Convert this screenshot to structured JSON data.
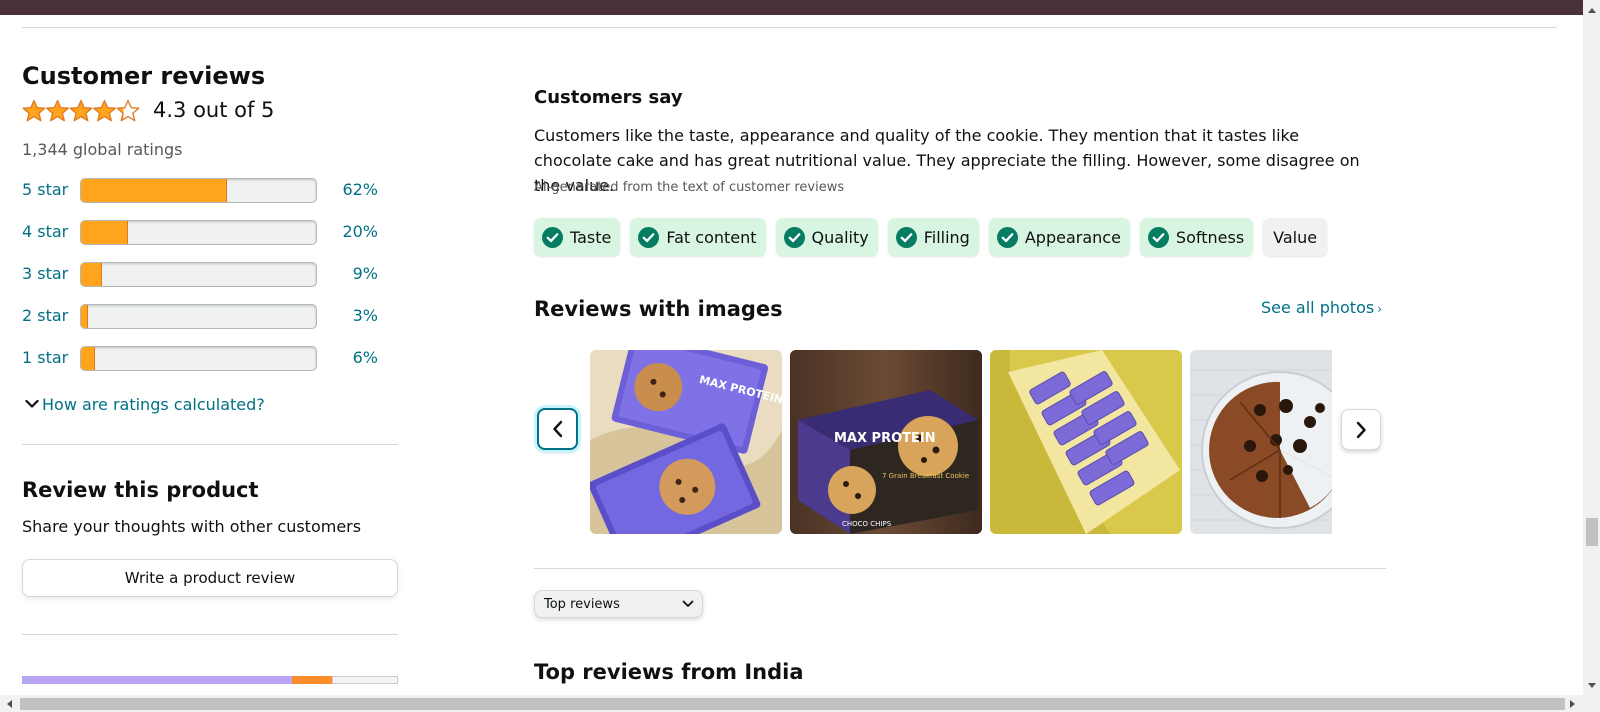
{
  "customer_reviews": {
    "title": "Customer reviews",
    "rating_text": "4.3 out of 5",
    "average_rating": 4.3,
    "global_ratings": "1,344 global ratings",
    "histogram": [
      {
        "label": "5 star",
        "percent_text": "62%",
        "percent": 62
      },
      {
        "label": "4 star",
        "percent_text": "20%",
        "percent": 20
      },
      {
        "label": "3 star",
        "percent_text": "9%",
        "percent": 9
      },
      {
        "label": "2 star",
        "percent_text": "3%",
        "percent": 3
      },
      {
        "label": "1 star",
        "percent_text": "6%",
        "percent": 6
      }
    ],
    "how_calculated": "How are ratings calculated?"
  },
  "review_product": {
    "title": "Review this product",
    "subtitle": "Share your thoughts with other customers",
    "button": "Write a product review"
  },
  "customers_say": {
    "title": "Customers say",
    "body": "Customers like the taste, appearance and quality of the cookie. They mention that it tastes like chocolate cake and has great nutritional value. They appreciate the filling. However, some disagree on the value.",
    "ai_note": "AI-generated from the text of customer reviews",
    "aspects": [
      {
        "label": "Taste",
        "sentiment": "positive"
      },
      {
        "label": "Fat content",
        "sentiment": "positive"
      },
      {
        "label": "Quality",
        "sentiment": "positive"
      },
      {
        "label": "Filling",
        "sentiment": "positive"
      },
      {
        "label": "Appearance",
        "sentiment": "positive"
      },
      {
        "label": "Softness",
        "sentiment": "positive"
      },
      {
        "label": "Value",
        "sentiment": "mixed"
      }
    ]
  },
  "reviews_with_images": {
    "title": "Reviews with images",
    "see_all": "See all photos",
    "see_all_icon": "chevron-right-small",
    "prev_icon": "chevron-left",
    "next_icon": "chevron-right",
    "packaging_text": {
      "brand": "MAX PROTEIN",
      "tagline": "7 Grain Breakfast Cookie",
      "flavor": "CHOCO CHIPS"
    }
  },
  "sort": {
    "selected": "Top reviews"
  },
  "top_reviews_title": "Top reviews from India",
  "colors": {
    "star": "#ffa41c",
    "link": "#007185",
    "positive_chip": "#d7f5e1",
    "check": "#067d62",
    "header_bar": "#4a3038"
  }
}
